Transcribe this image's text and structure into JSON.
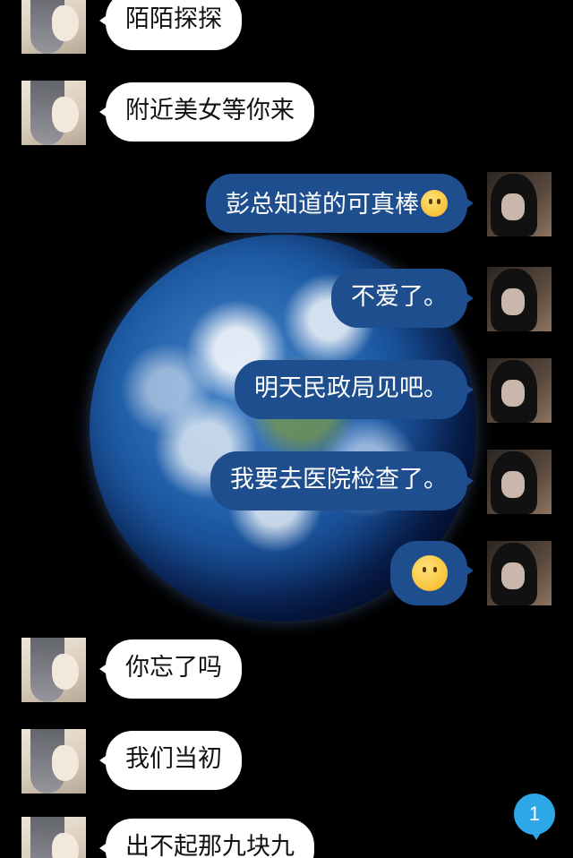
{
  "background": {
    "image": "earth-globe"
  },
  "colors": {
    "outgoing_bubble": "#1f4e8e",
    "incoming_bubble": "#ffffff",
    "badge": "#2ea7e8"
  },
  "messages": [
    {
      "side": "left",
      "text": "陌陌探探"
    },
    {
      "side": "left",
      "text": "附近美女等你来"
    },
    {
      "side": "right",
      "text": "彭总知道的可真棒",
      "emoji": "thinking-face"
    },
    {
      "side": "right",
      "text": "不爱了。"
    },
    {
      "side": "right",
      "text": "明天民政局见吧。"
    },
    {
      "side": "right",
      "text": "我要去医院检查了。"
    },
    {
      "side": "right",
      "text": "",
      "emoji": "thinking-face"
    },
    {
      "side": "left",
      "text": "你忘了吗"
    },
    {
      "side": "left",
      "text": "我们当初"
    },
    {
      "side": "left",
      "text": "出不起那九块九"
    }
  ],
  "unread_badge": {
    "count": "1"
  }
}
